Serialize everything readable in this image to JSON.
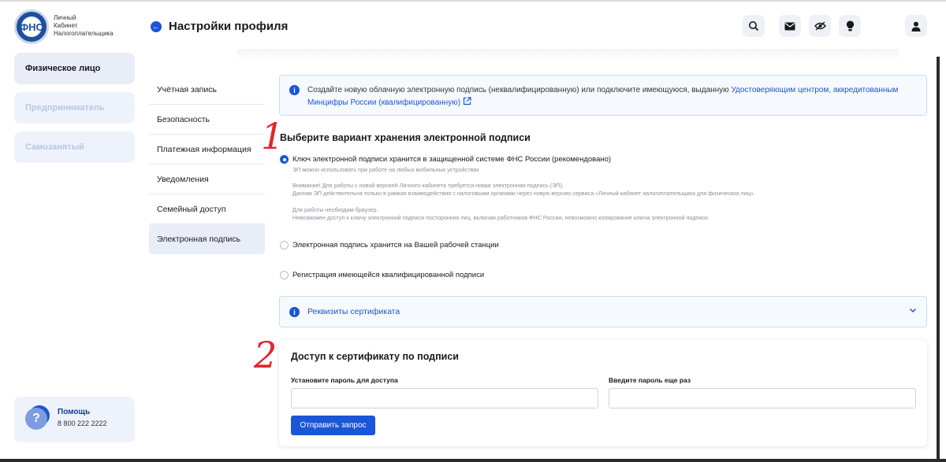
{
  "brand": {
    "logo_emblem": "ФНС",
    "name_lines": [
      "Личный",
      "Кабинет",
      "Налогоплательщика"
    ]
  },
  "sidebar": {
    "items": [
      {
        "label": "Физическое лицо",
        "active": true
      },
      {
        "label": "Предприниматель",
        "active": false
      },
      {
        "label": "Самозанятый",
        "active": false
      }
    ],
    "help": {
      "title": "Помощь",
      "phone": "8 800 222 2222"
    }
  },
  "header": {
    "title": "Настройки профиля",
    "icons": [
      "search-icon",
      "mail-icon",
      "eye-off-icon",
      "lightbulb-icon",
      "user-icon"
    ]
  },
  "settings_menu": {
    "items": [
      {
        "label": "Учётная запись"
      },
      {
        "label": "Безопасность"
      },
      {
        "label": "Платежная информация"
      },
      {
        "label": "Уведомления"
      },
      {
        "label": "Семейный доступ"
      },
      {
        "label": "Электронная подпись",
        "selected": true
      }
    ]
  },
  "info": {
    "text": "Создайте новую облачную электронную подпись (неквалифицированную) или подключите имеющуюся, выданную ",
    "link": "Удостоверяющим центром, аккредитованным Минцифры России (квалифицированную)"
  },
  "storage": {
    "title": "Выберите вариант хранения электронной подписи",
    "options": [
      {
        "label": "Ключ электронной подписи хранится в защищенной системе ФНС России (рекомендовано)",
        "checked": true,
        "notes": [
          "ЭП можно использовать при работе на любых мобильных устройствах",
          "Внимание! Для работы с новой версией Личного кабинета требуется новая электронная подпись (ЭП).",
          "Данная ЭП действительна только в рамках взаимодействия с налоговыми органами через новую версию сервиса «Личный кабинет налогоплательщика для физических лиц»",
          "Для работы необходим браузер.",
          "Невозможен доступ к ключу электронной подписи посторонних лиц, включая работников ФНС России, невозможно копирование ключа электронной подписи"
        ]
      },
      {
        "label": "Электронная подпись хранится на Вашей рабочей станции",
        "checked": false
      },
      {
        "label": "Регистрация имеющейся квалифицированной подписи",
        "checked": false
      }
    ]
  },
  "certificate": {
    "label": "Реквизиты сертификата",
    "expanded": false
  },
  "access": {
    "title": "Доступ к сертификату по подписи",
    "password_label": "Установите пароль для доступа",
    "password_value": "",
    "repeat_label": "Введите пароль еще раз",
    "repeat_value": "",
    "submit_label": "Отправить запрос"
  },
  "annotations": {
    "first": "1",
    "second": "2"
  },
  "colors": {
    "accent": "#1a56d6",
    "annotation": "#e0262d",
    "panel": "#e8edf8"
  }
}
